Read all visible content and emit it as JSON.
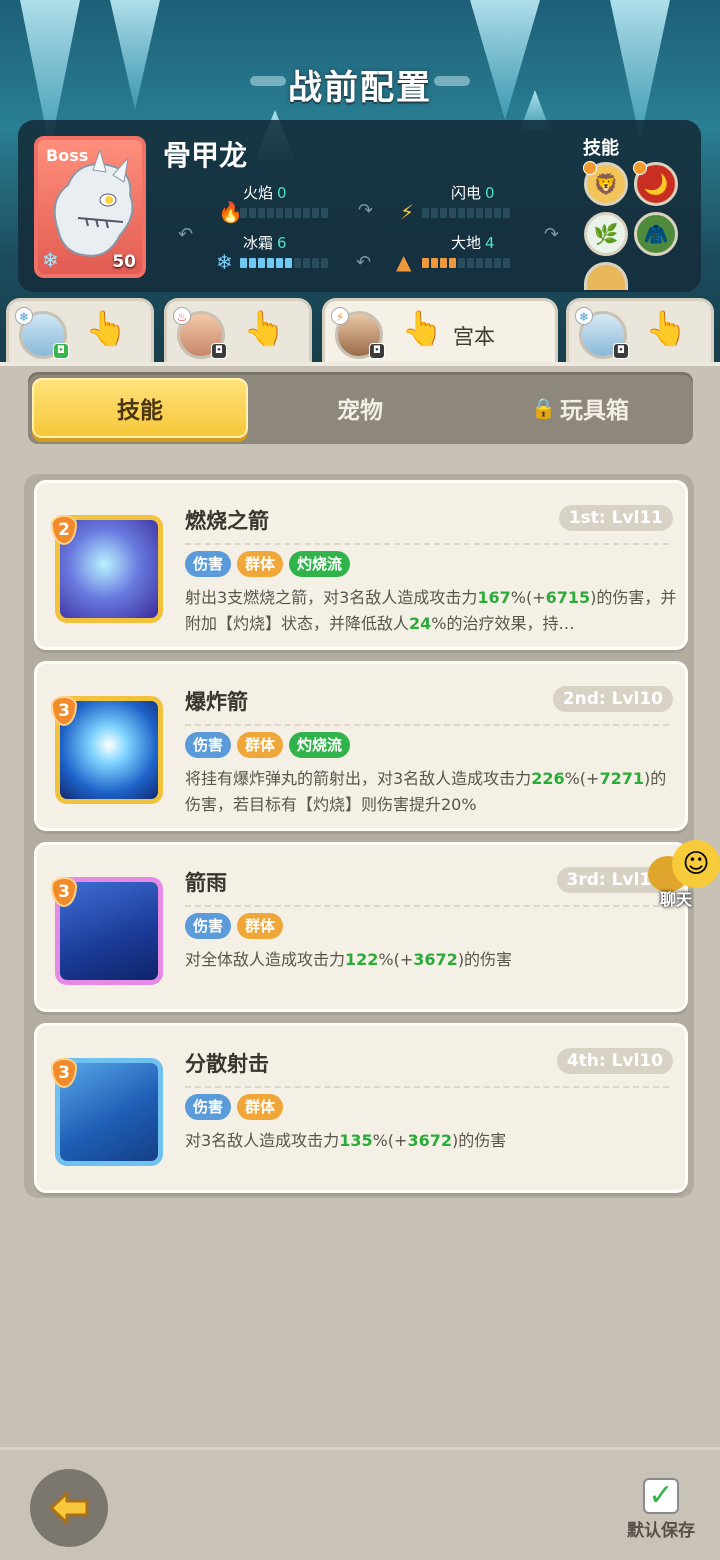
{
  "header": {
    "title": "战前配置"
  },
  "boss": {
    "tag": "Boss",
    "name": "骨甲龙",
    "level": "50",
    "elements": [
      {
        "label": "火焰",
        "value": "0"
      },
      {
        "label": "闪电",
        "value": "0"
      },
      {
        "label": "冰霜",
        "value": "6"
      },
      {
        "label": "大地",
        "value": "4"
      }
    ],
    "skills_label": "技能"
  },
  "heroes": [
    {
      "name": ""
    },
    {
      "name": ""
    },
    {
      "name": "宫本"
    },
    {
      "name": ""
    }
  ],
  "segments": [
    {
      "label": "技能"
    },
    {
      "label": "宠物"
    },
    {
      "label": "玩具箱"
    }
  ],
  "skills": [
    {
      "rank": "2",
      "title": "燃烧之箭",
      "level": "1st: Lvl11",
      "tags": [
        "伤害",
        "群体",
        "灼烧流"
      ],
      "desc": {
        "p1": "射出3支燃烧之箭，对3名敌人造成攻击力",
        "n1": "167",
        "p2": "%(+",
        "n2": "6715",
        "p3": ")的伤害，并附加【灼烧】状态，并降低敌人",
        "n3": "24",
        "p4": "%的治疗效果，持…"
      }
    },
    {
      "rank": "3",
      "title": "爆炸箭",
      "level": "2nd: Lvl10",
      "tags": [
        "伤害",
        "群体",
        "灼烧流"
      ],
      "desc": {
        "p1": "将挂有爆炸弹丸的箭射出，对3名敌人造成攻击力",
        "n1": "226",
        "p2": "%(+",
        "n2": "7271",
        "p3": ")的伤害，若目标有【灼烧】则伤害提升20%"
      }
    },
    {
      "rank": "3",
      "title": "箭雨",
      "level": "3rd: Lvl10",
      "tags": [
        "伤害",
        "群体"
      ],
      "desc": {
        "p1": "对全体敌人造成攻击力",
        "n1": "122",
        "p2": "%(+",
        "n2": "3672",
        "p3": ")的伤害"
      }
    },
    {
      "rank": "3",
      "title": "分散射击",
      "level": "4th: Lvl10",
      "tags": [
        "伤害",
        "群体"
      ],
      "desc": {
        "p1": "对3名敌人造成攻击力",
        "n1": "135",
        "p2": "%(+",
        "n2": "3672",
        "p3": ")的伤害"
      }
    }
  ],
  "chat": {
    "label": "聊天"
  },
  "footer": {
    "save_label": "默认保存"
  },
  "colors": {
    "accent": "#f6c73a",
    "highlight_number": "#2cab3b",
    "tag_damage": "#5b9bd9",
    "tag_group": "#f0a739",
    "tag_burn": "#2fb34a"
  },
  "icons": {
    "back": "arrow-left-icon",
    "save": "checkbox-icon",
    "lock": "lock-icon",
    "hand": "tap-hand-icon"
  }
}
